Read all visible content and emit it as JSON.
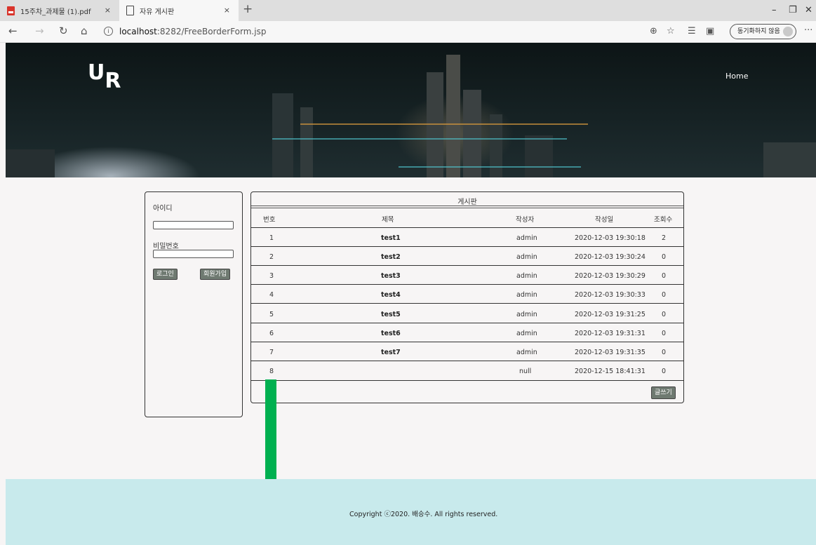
{
  "browser": {
    "tabs": [
      {
        "label": "15주차_과제물 (1).pdf",
        "icon": "pdf-icon",
        "active": false
      },
      {
        "label": "자유 게시판",
        "icon": "document-icon",
        "active": true
      }
    ],
    "url_host": "localhost",
    "url_path": ":8282/FreeBorderForm.jsp",
    "sync_label": "동기화하지 않음",
    "close_glyph": "×",
    "new_tab_glyph": "+"
  },
  "header": {
    "logo_u": "U",
    "logo_r": "R",
    "nav_home": "Home"
  },
  "login": {
    "id_label": "아이디",
    "pw_label": "비밀번호",
    "login_button": "로그인",
    "signup_button": "회원가입"
  },
  "board": {
    "title": "게시판",
    "columns": [
      "번호",
      "제목",
      "작성자",
      "작성일",
      "조회수"
    ],
    "rows": [
      {
        "no": "1",
        "title": "test1",
        "author": "admin",
        "date": "2020-12-03 19:30:18",
        "views": "2"
      },
      {
        "no": "2",
        "title": "test2",
        "author": "admin",
        "date": "2020-12-03 19:30:24",
        "views": "0"
      },
      {
        "no": "3",
        "title": "test3",
        "author": "admin",
        "date": "2020-12-03 19:30:29",
        "views": "0"
      },
      {
        "no": "4",
        "title": "test4",
        "author": "admin",
        "date": "2020-12-03 19:30:33",
        "views": "0"
      },
      {
        "no": "5",
        "title": "test5",
        "author": "admin",
        "date": "2020-12-03 19:31:25",
        "views": "0"
      },
      {
        "no": "6",
        "title": "test6",
        "author": "admin",
        "date": "2020-12-03 19:31:31",
        "views": "0"
      },
      {
        "no": "7",
        "title": "test7",
        "author": "admin",
        "date": "2020-12-03 19:31:35",
        "views": "0"
      },
      {
        "no": "8",
        "title": "",
        "author": "null",
        "date": "2020-12-15 18:41:31",
        "views": "0"
      }
    ],
    "write_button": "글쓰기"
  },
  "footer": {
    "copyright": "Copyright ⓒ2020. 배승수. All rights reserved."
  },
  "colors": {
    "button_bg": "#6f7a71",
    "footer_bg": "#c8eaec",
    "annotation_green": "#00b050"
  }
}
